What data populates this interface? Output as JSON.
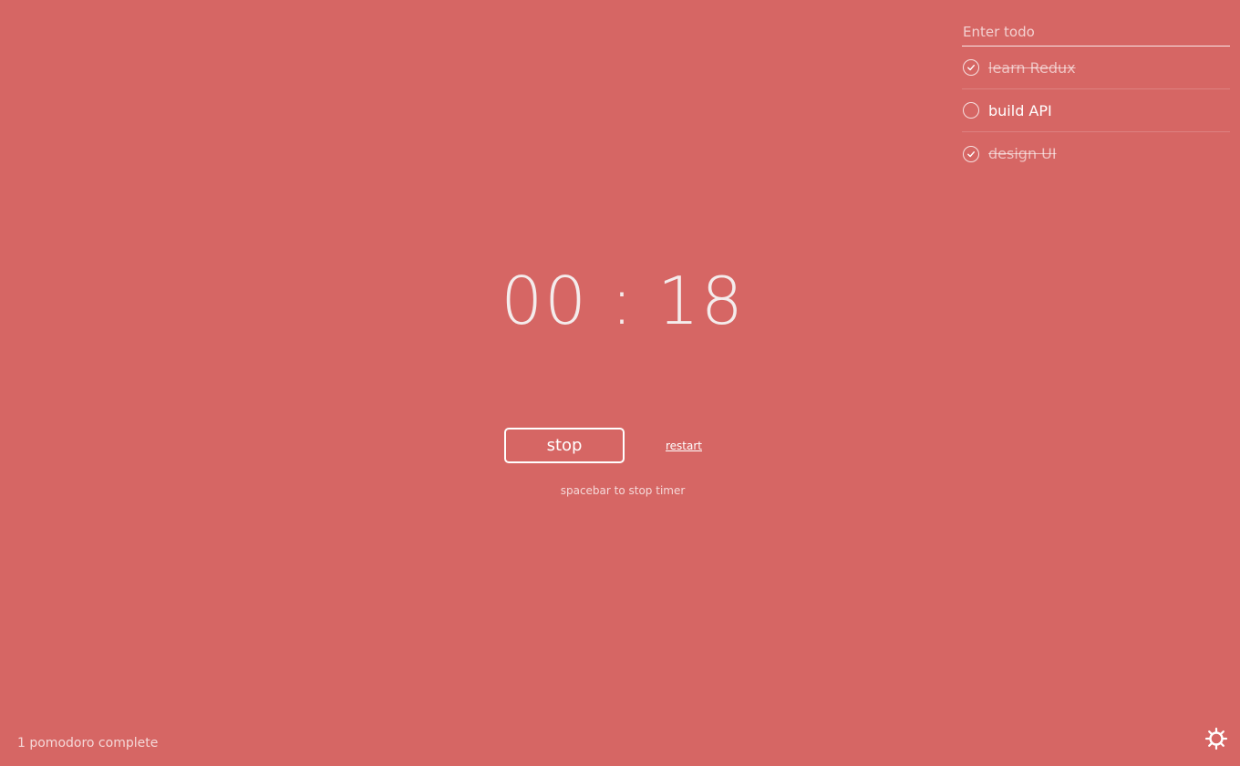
{
  "todo": {
    "placeholder": "Enter todo",
    "items": [
      {
        "label": "learn Redux",
        "done": true
      },
      {
        "label": "build API",
        "done": false
      },
      {
        "label": "design UI",
        "done": true
      }
    ]
  },
  "timer": {
    "display": "00 : 18"
  },
  "controls": {
    "stop_label": "stop",
    "restart_label": "restart",
    "hint": "spacebar to stop timer"
  },
  "footer": {
    "status": "1 pomodoro complete",
    "settings_icon": "gear-icon"
  },
  "colors": {
    "background": "#d66664",
    "text": "#ffffff"
  }
}
